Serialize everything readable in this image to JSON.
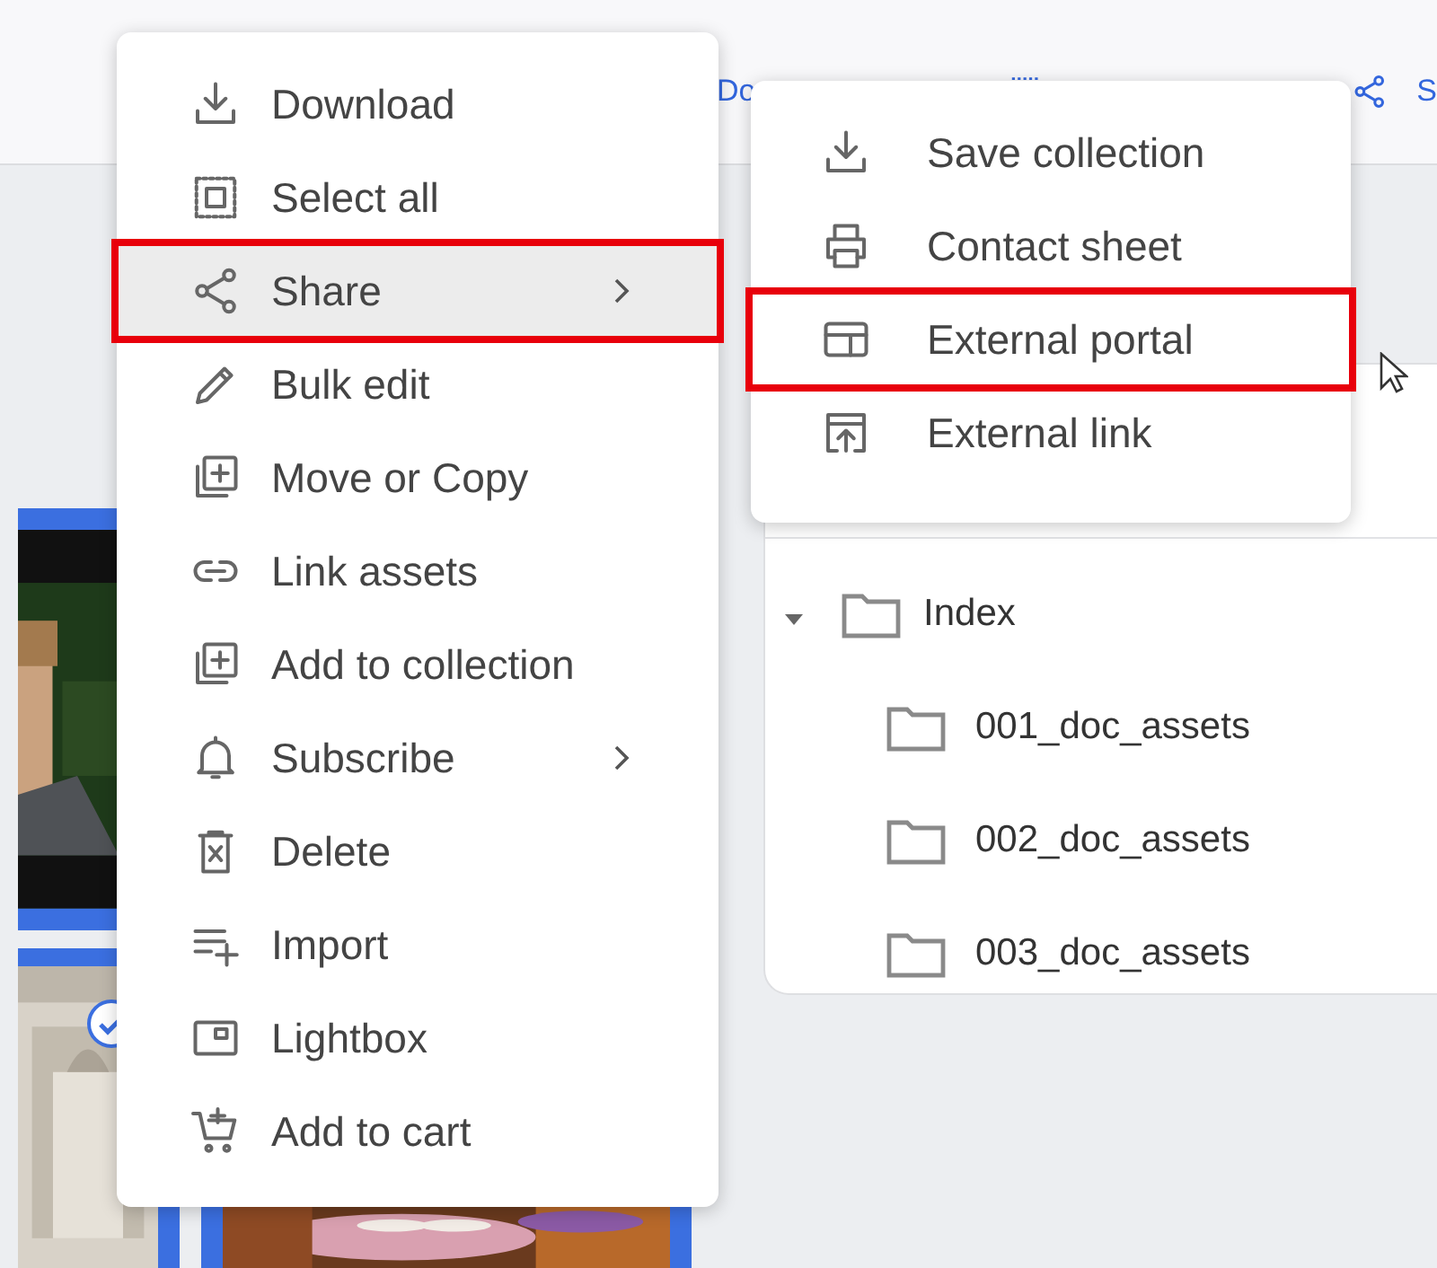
{
  "toolbar": {
    "download_label": "Do",
    "share_label": "S"
  },
  "gallery": {
    "tiles": [
      {
        "kind": "picture",
        "selected": false
      },
      {
        "kind": "picture",
        "selected": true
      },
      {
        "kind": "picture",
        "selected": false
      }
    ]
  },
  "folder_tree": [
    {
      "name": "Index",
      "expanded": true,
      "children": [
        {
          "name": "001_doc_assets"
        },
        {
          "name": "002_doc_assets"
        },
        {
          "name": "003_doc_assets"
        }
      ]
    }
  ],
  "context_menu": {
    "items": [
      {
        "label": "Download",
        "submenu": false,
        "selected": false,
        "highlighted": false
      },
      {
        "label": "Select all",
        "submenu": false,
        "selected": false,
        "highlighted": false
      },
      {
        "label": "Share",
        "submenu": true,
        "selected": true,
        "highlighted": true
      },
      {
        "label": "Bulk edit",
        "submenu": false,
        "selected": false,
        "highlighted": false
      },
      {
        "label": "Move or Copy",
        "submenu": false,
        "selected": false,
        "highlighted": false
      },
      {
        "label": "Link assets",
        "submenu": false,
        "selected": false,
        "highlighted": false
      },
      {
        "label": "Add to collection",
        "submenu": false,
        "selected": false,
        "highlighted": false
      },
      {
        "label": "Subscribe",
        "submenu": true,
        "selected": false,
        "highlighted": false
      },
      {
        "label": "Delete",
        "submenu": false,
        "selected": false,
        "highlighted": false
      },
      {
        "label": "Import",
        "submenu": false,
        "selected": false,
        "highlighted": false
      },
      {
        "label": "Lightbox",
        "submenu": false,
        "selected": false,
        "highlighted": false
      },
      {
        "label": "Add to cart",
        "submenu": false,
        "selected": false,
        "highlighted": false
      }
    ]
  },
  "share_submenu": {
    "items": [
      {
        "label": "Save collection",
        "selected": false,
        "highlighted": false
      },
      {
        "label": "Contact sheet",
        "selected": false,
        "highlighted": false
      },
      {
        "label": "External portal",
        "selected": false,
        "highlighted": true
      },
      {
        "label": "External link",
        "selected": false,
        "highlighted": false
      }
    ]
  }
}
